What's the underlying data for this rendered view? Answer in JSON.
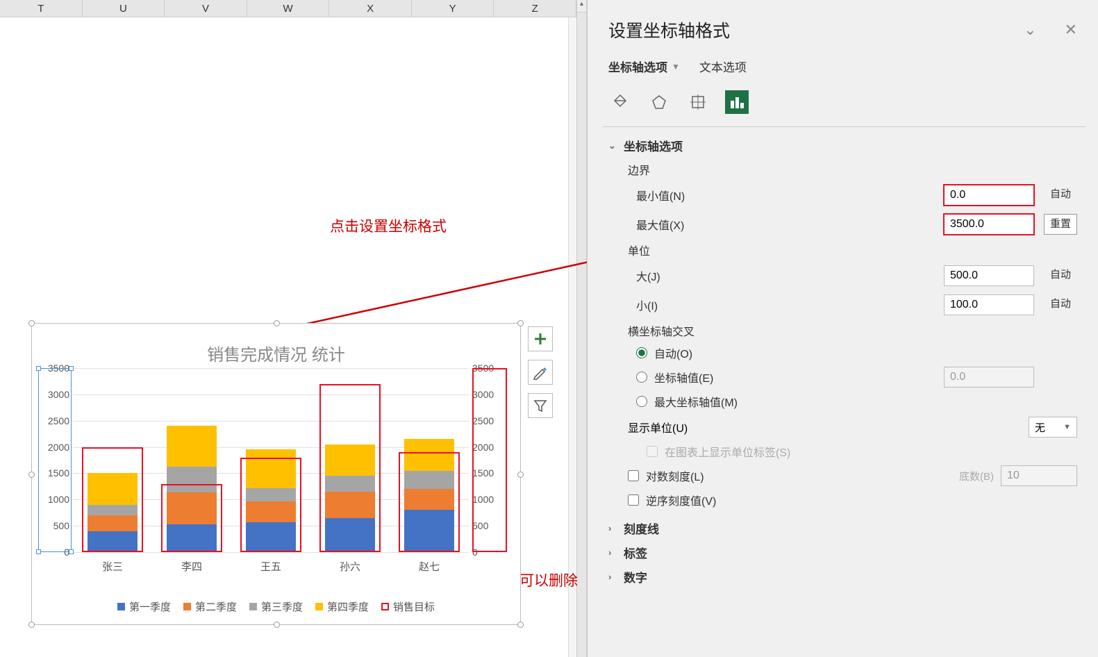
{
  "columns": [
    "T",
    "U",
    "V",
    "W",
    "X",
    "Y",
    "Z"
  ],
  "annotations": {
    "click_axis_format": "点击设置坐标格式",
    "can_delete_here": "这里就可以删除"
  },
  "chart_btns": {
    "plus": "+",
    "brush": "brush",
    "filter": "filter"
  },
  "chart": {
    "title": "销售完成情况 统计",
    "categories": [
      "张三",
      "李四",
      "王五",
      "孙六",
      "赵七"
    ],
    "y_ticks": [
      0,
      500,
      1000,
      1500,
      2000,
      2500,
      3000,
      3500
    ],
    "legend": [
      "第一季度",
      "第二季度",
      "第三季度",
      "第四季度",
      "销售目标"
    ]
  },
  "chart_data": {
    "type": "bar",
    "title": "销售完成情况 统计",
    "categories": [
      "张三",
      "李四",
      "王五",
      "孙六",
      "赵七"
    ],
    "series": [
      {
        "name": "第一季度",
        "values": [
          400,
          530,
          570,
          650,
          800
        ]
      },
      {
        "name": "第二季度",
        "values": [
          300,
          600,
          400,
          500,
          400
        ]
      },
      {
        "name": "第三季度",
        "values": [
          200,
          500,
          250,
          300,
          350
        ]
      },
      {
        "name": "第四季度",
        "values": [
          600,
          770,
          730,
          600,
          600
        ]
      }
    ],
    "target": {
      "name": "销售目标",
      "values": [
        2000,
        1300,
        1800,
        3200,
        1900
      ]
    },
    "ylabel": "",
    "xlabel": "",
    "ylim": [
      0,
      3500
    ],
    "secondary_ylim": [
      0,
      3500
    ]
  },
  "panel": {
    "title": "设置坐标轴格式",
    "tab1": "坐标轴选项",
    "tab2": "文本选项",
    "section_axis_options": "坐标轴选项",
    "bounds": "边界",
    "min_label": "最小值(N)",
    "min_value": "0.0",
    "min_btn": "自动",
    "max_label": "最大值(X)",
    "max_value": "3500.0",
    "max_btn": "重置",
    "units": "单位",
    "major_label": "大(J)",
    "major_value": "500.0",
    "major_btn": "自动",
    "minor_label": "小(I)",
    "minor_value": "100.0",
    "minor_btn": "自动",
    "cross": "横坐标轴交叉",
    "cross_auto": "自动(O)",
    "cross_value": "坐标轴值(E)",
    "cross_value_input": "0.0",
    "cross_max": "最大坐标轴值(M)",
    "display_unit_label": "显示单位(U)",
    "display_unit_value": "无",
    "show_unit_label": "在图表上显示单位标签(S)",
    "log_scale": "对数刻度(L)",
    "log_base_label": "底数(B)",
    "log_base_value": "10",
    "reverse": "逆序刻度值(V)",
    "section_ticks": "刻度线",
    "section_labels": "标签",
    "section_number": "数字"
  }
}
